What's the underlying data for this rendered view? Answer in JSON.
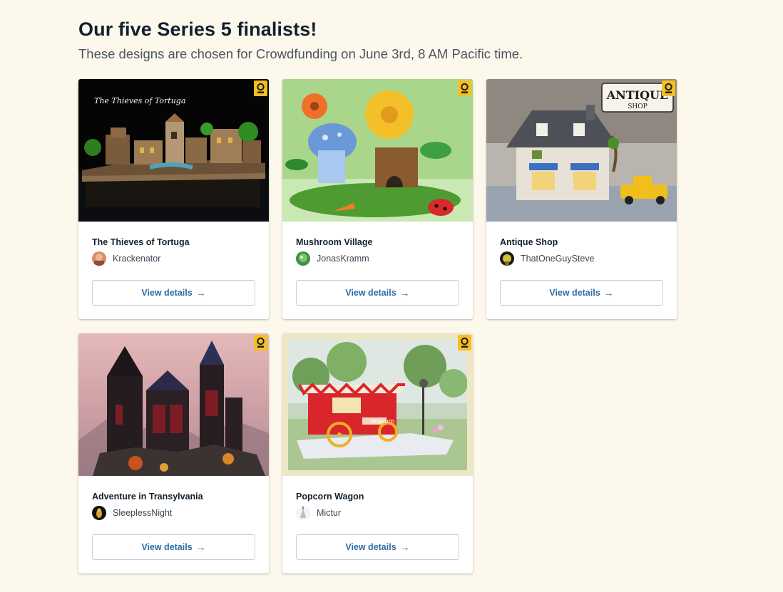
{
  "header": {
    "title": "Our five Series 5 finalists!",
    "subtitle": "These designs are chosen for Crowdfunding on June 3rd, 8 AM Pacific time."
  },
  "finalists": [
    {
      "title": "The Thieves of Tortuga",
      "author": "Krackenator",
      "button_label": "View details",
      "button_icon": "arrow-right-icon",
      "image_caption": "The Thieves of Tortuga",
      "badge_icon": "ideas-badge-icon"
    },
    {
      "title": "Mushroom Village",
      "author": "JonasKramm",
      "button_label": "View details",
      "button_icon": "arrow-right-icon",
      "badge_icon": "ideas-badge-icon"
    },
    {
      "title": "Antique Shop",
      "author": "ThatOneGuySteve",
      "button_label": "View details",
      "button_icon": "arrow-right-icon",
      "image_sign_top": "ANTIQUE",
      "image_sign_bottom": "SHOP",
      "badge_icon": "ideas-badge-icon"
    },
    {
      "title": "Adventure in Transylvania",
      "author": "SleeplessNight",
      "button_label": "View details",
      "button_icon": "arrow-right-icon",
      "badge_icon": "ideas-badge-icon"
    },
    {
      "title": "Popcorn Wagon",
      "author": "Mictur",
      "button_label": "View details",
      "button_icon": "arrow-right-icon",
      "image_sign": "Popcorn",
      "badge_icon": "ideas-badge-icon"
    }
  ],
  "colors": {
    "background": "#fdf8ec",
    "link": "#2e6da4",
    "badge": "#f5bf22"
  }
}
